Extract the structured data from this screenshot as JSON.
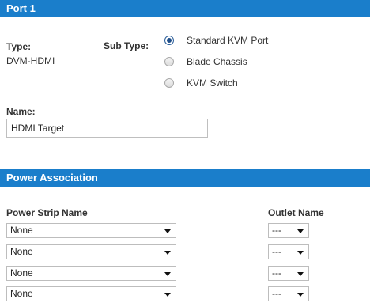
{
  "port_section": {
    "title": "Port 1",
    "type_label": "Type:",
    "type_value": "DVM-HDMI",
    "subtype_label": "Sub Type:",
    "subtype_options": [
      {
        "label": "Standard KVM Port",
        "checked": true
      },
      {
        "label": "Blade Chassis",
        "checked": false
      },
      {
        "label": "KVM Switch",
        "checked": false
      }
    ],
    "name_label": "Name:",
    "name_value": "HDMI Target"
  },
  "power_section": {
    "title": "Power Association",
    "strip_header": "Power Strip Name",
    "outlet_header": "Outlet Name",
    "rows": [
      {
        "strip": "None",
        "outlet": "---"
      },
      {
        "strip": "None",
        "outlet": "---"
      },
      {
        "strip": "None",
        "outlet": "---"
      },
      {
        "strip": "None",
        "outlet": "---"
      }
    ]
  },
  "colors": {
    "section_bar": "#1a7ecb",
    "text": "#333333"
  }
}
